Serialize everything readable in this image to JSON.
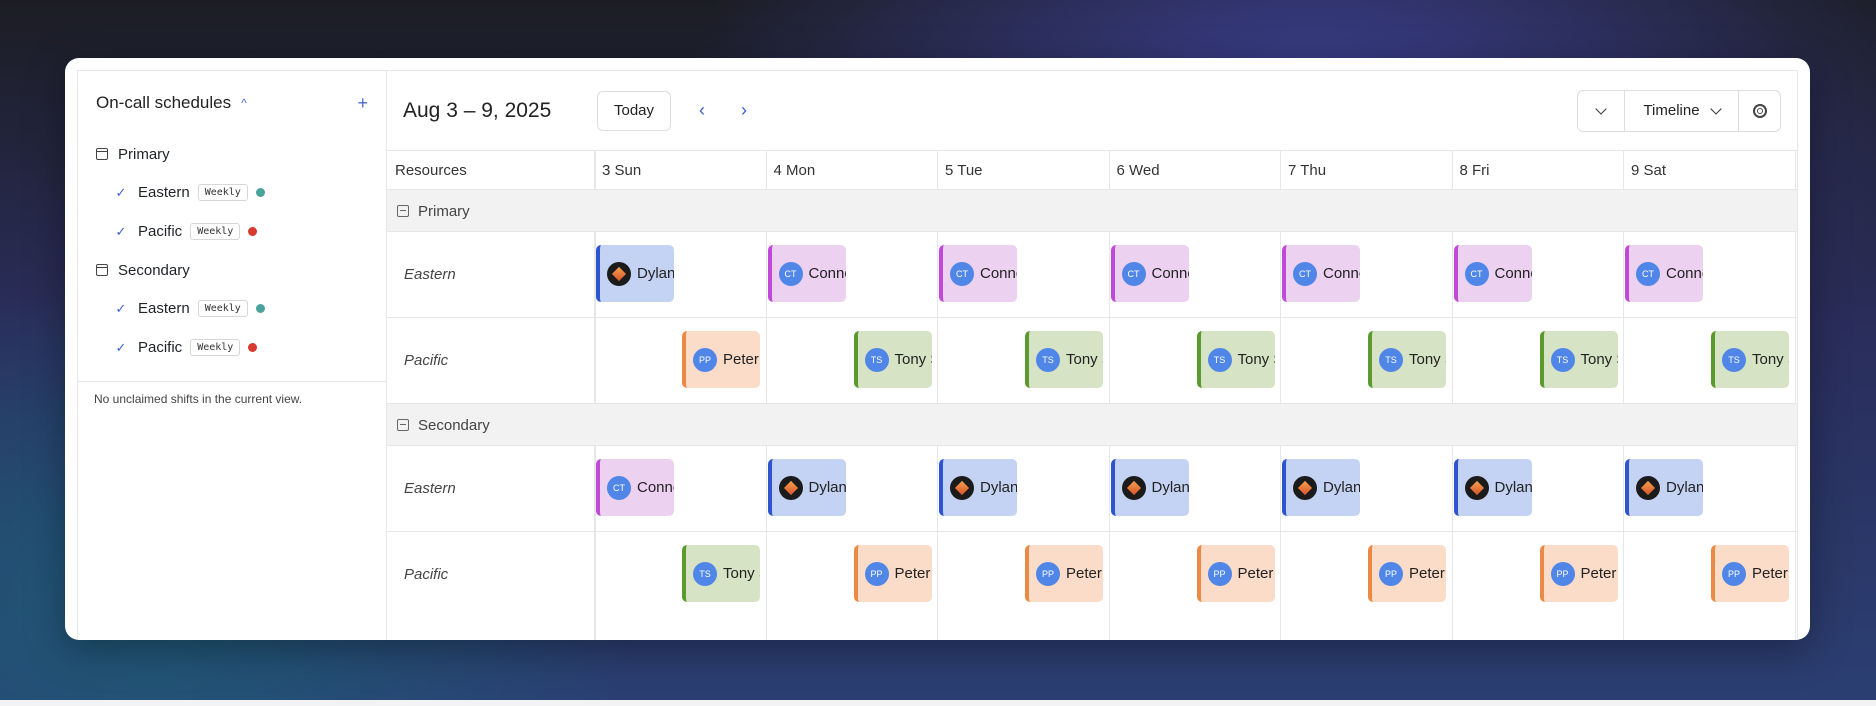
{
  "sidebar": {
    "title": "On-call schedules",
    "add_label": "+",
    "groups": [
      {
        "label": "Primary",
        "schedules": [
          {
            "name": "Eastern",
            "badge": "Weekly",
            "color": "#4aa39a"
          },
          {
            "name": "Pacific",
            "badge": "Weekly",
            "color": "#d93a2f"
          }
        ]
      },
      {
        "label": "Secondary",
        "schedules": [
          {
            "name": "Eastern",
            "badge": "Weekly",
            "color": "#4aa39a"
          },
          {
            "name": "Pacific",
            "badge": "Weekly",
            "color": "#d93a2f"
          }
        ]
      }
    ],
    "note": "No unclaimed shifts in the current view."
  },
  "toolbar": {
    "range": "Aug 3 – 9, 2025",
    "today_label": "Today",
    "view_label": "Timeline"
  },
  "grid": {
    "resources_label": "Resources",
    "days": [
      "3 Sun",
      "4 Mon",
      "5 Tue",
      "6 Wed",
      "7 Thu",
      "8 Fri",
      "9 Sat"
    ],
    "sections": [
      {
        "label": "Primary",
        "rows": [
          {
            "label": "Eastern",
            "events": [
              {
                "text": "Dylan",
                "kind": "dylan",
                "avatar": ""
              },
              {
                "text": "Conno",
                "kind": "conn",
                "avatar": "CT"
              },
              {
                "text": "Conno",
                "kind": "conn",
                "avatar": "CT"
              },
              {
                "text": "Conno",
                "kind": "conn",
                "avatar": "CT"
              },
              {
                "text": "Conno",
                "kind": "conn",
                "avatar": "CT"
              },
              {
                "text": "Conno",
                "kind": "conn",
                "avatar": "CT"
              },
              {
                "text": "Conno",
                "kind": "conn",
                "avatar": "CT"
              }
            ]
          },
          {
            "label": "Pacific",
            "events": [
              {
                "text": "Peter I",
                "kind": "peter",
                "avatar": "PP"
              },
              {
                "text": "Tony S",
                "kind": "tony",
                "avatar": "TS"
              },
              {
                "text": "Tony S",
                "kind": "tony",
                "avatar": "TS"
              },
              {
                "text": "Tony S",
                "kind": "tony",
                "avatar": "TS"
              },
              {
                "text": "Tony S",
                "kind": "tony",
                "avatar": "TS"
              },
              {
                "text": "Tony S",
                "kind": "tony",
                "avatar": "TS"
              },
              {
                "text": "Tony S",
                "kind": "tony",
                "avatar": "TS"
              }
            ]
          }
        ]
      },
      {
        "label": "Secondary",
        "rows": [
          {
            "label": "Eastern",
            "events": [
              {
                "text": "Conno",
                "kind": "conn",
                "avatar": "CT"
              },
              {
                "text": "Dylan",
                "kind": "dylan",
                "avatar": ""
              },
              {
                "text": "Dylan",
                "kind": "dylan",
                "avatar": ""
              },
              {
                "text": "Dylan",
                "kind": "dylan",
                "avatar": ""
              },
              {
                "text": "Dylan",
                "kind": "dylan",
                "avatar": ""
              },
              {
                "text": "Dylan",
                "kind": "dylan",
                "avatar": ""
              },
              {
                "text": "Dylan",
                "kind": "dylan",
                "avatar": ""
              }
            ]
          },
          {
            "label": "Pacific",
            "events": [
              {
                "text": "Tony S",
                "kind": "tony",
                "avatar": "TS"
              },
              {
                "text": "Peter I",
                "kind": "peter",
                "avatar": "PP"
              },
              {
                "text": "Peter I",
                "kind": "peter",
                "avatar": "PP"
              },
              {
                "text": "Peter I",
                "kind": "peter",
                "avatar": "PP"
              },
              {
                "text": "Peter I",
                "kind": "peter",
                "avatar": "PP"
              },
              {
                "text": "Peter I",
                "kind": "peter",
                "avatar": "PP"
              },
              {
                "text": "Peter P",
                "kind": "peter",
                "avatar": "PP"
              }
            ]
          }
        ]
      }
    ]
  }
}
